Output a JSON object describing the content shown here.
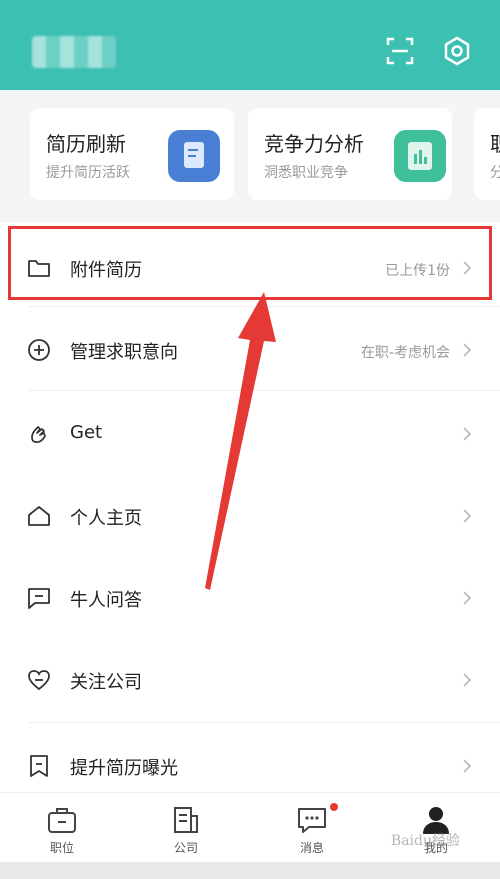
{
  "header": {
    "bg": "#3cc0b2",
    "scan_icon": "scan-icon",
    "settings_icon": "settings-icon"
  },
  "cards": [
    {
      "title": "简历刷新",
      "subtitle": "提升简历活跃",
      "icon": "resume-refresh-icon",
      "color": "#4a7fd6"
    },
    {
      "title": "竞争力分析",
      "subtitle": "洞悉职业竞争",
      "icon": "analysis-icon",
      "color": "#3fbf9a"
    },
    {
      "title": "职",
      "subtitle": "分"
    }
  ],
  "menu": {
    "items": [
      {
        "label": "附件简历",
        "value": "已上传1份",
        "icon": "folder-icon"
      },
      {
        "label": "管理求职意向",
        "value": "在职-考虑机会",
        "icon": "plus-circle-icon"
      },
      {
        "label": "Get",
        "value": "",
        "icon": "hand-icon"
      },
      {
        "label": "个人主页",
        "value": "",
        "icon": "home-icon"
      },
      {
        "label": "牛人问答",
        "value": "",
        "icon": "chat-icon"
      },
      {
        "label": "关注公司",
        "value": "",
        "icon": "heart-icon"
      },
      {
        "label": "提升简历曝光",
        "value": "",
        "icon": "bookmark-icon"
      }
    ]
  },
  "tabs": [
    {
      "label": "职位",
      "icon": "briefcase-icon"
    },
    {
      "label": "公司",
      "icon": "building-icon"
    },
    {
      "label": "消息",
      "icon": "message-icon"
    },
    {
      "label": "我的",
      "icon": "person-icon"
    }
  ],
  "watermark": "Baidu经验",
  "accent": "#e53935"
}
